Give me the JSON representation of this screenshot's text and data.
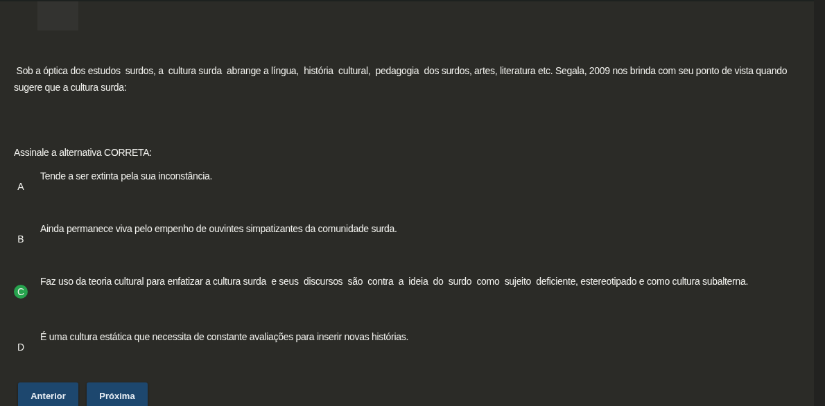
{
  "question": {
    "text": " Sob a óptica dos estudos  surdos, a  cultura surda  abrange a língua,  história  cultural,  pedagogia  dos surdos, artes, literatura etc. Segala, 2009 nos brinda com seu ponto de vista quando sugere que a cultura surda:",
    "instruction": "Assinale a alternativa CORRETA:"
  },
  "options": [
    {
      "letter": "A",
      "text": "Tende a ser extinta pela sua inconstância.",
      "selected": false
    },
    {
      "letter": "B",
      "text": "Ainda permanece viva pelo empenho de ouvintes simpatizantes da comunidade surda.",
      "selected": false
    },
    {
      "letter": "C",
      "text": "Faz uso da teoria cultural para enfatizar a cultura surda  e seus  discursos  são  contra  a  ideia  do  surdo  como  sujeito  deficiente, estereotipado e como cultura subalterna.",
      "selected": true
    },
    {
      "letter": "D",
      "text": "É uma cultura estática que necessita de constante avaliações para inserir novas histórias.",
      "selected": false
    }
  ],
  "buttons": [
    "Anterior",
    "Próxima"
  ]
}
